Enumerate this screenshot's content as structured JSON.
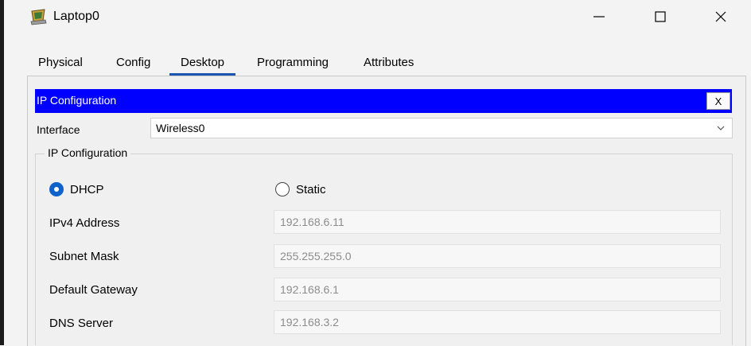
{
  "window": {
    "title": "Laptop0",
    "icon": "laptop-device-icon",
    "controls": {
      "minimize": "minimize-icon",
      "maximize": "maximize-icon",
      "close": "close-icon"
    }
  },
  "tabs": [
    {
      "label": "Physical"
    },
    {
      "label": "Config"
    },
    {
      "label": "Desktop",
      "active": true
    },
    {
      "label": "Programming"
    },
    {
      "label": "Attributes"
    }
  ],
  "ip_config": {
    "header_title": "IP Configuration",
    "close_label": "X",
    "interface_label": "Interface",
    "interface_value": "Wireless0",
    "group_title": "IP Configuration",
    "dhcp_label": "DHCP",
    "static_label": "Static",
    "mode": "DHCP",
    "fields": [
      {
        "label": "IPv4 Address",
        "value": "192.168.6.11"
      },
      {
        "label": "Subnet Mask",
        "value": "255.255.255.0"
      },
      {
        "label": "Default Gateway",
        "value": "192.168.6.1"
      },
      {
        "label": "DNS Server",
        "value": "192.168.3.2"
      }
    ]
  },
  "colors": {
    "header_bar": "#0000ff",
    "accent": "#0f62c9",
    "tab_underline": "#1a56b0"
  }
}
